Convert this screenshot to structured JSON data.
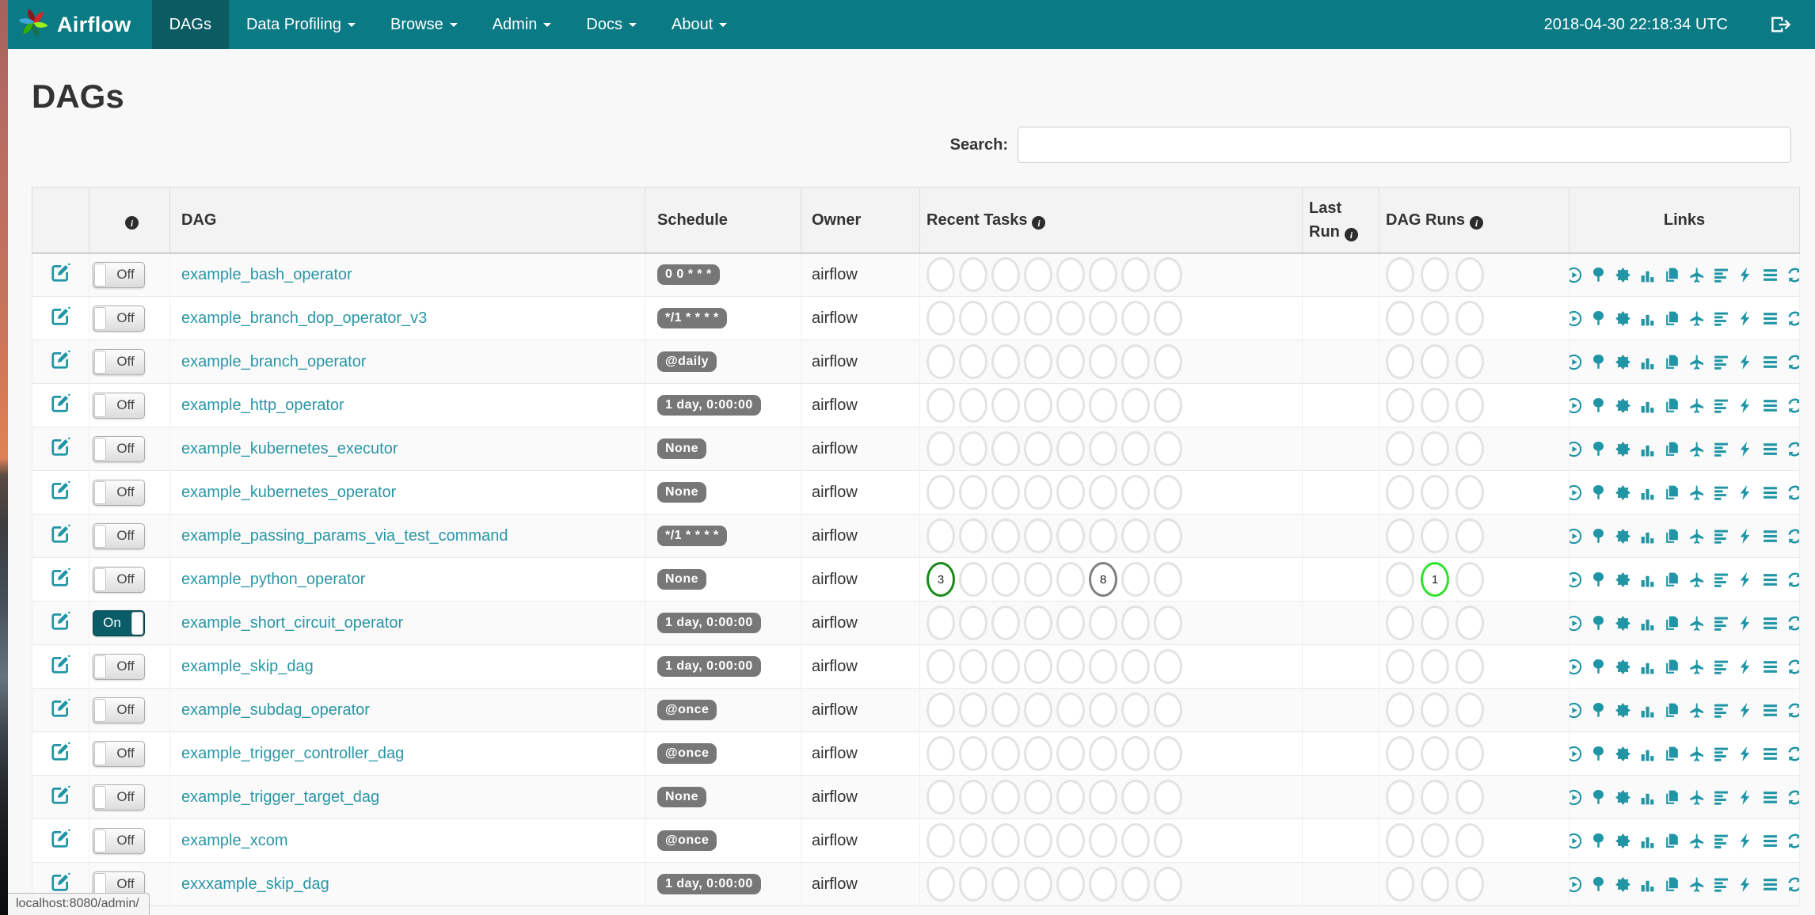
{
  "navbar": {
    "brand": "Airflow",
    "items": [
      {
        "label": "DAGs",
        "active": true,
        "caret": false
      },
      {
        "label": "Data Profiling",
        "active": false,
        "caret": true
      },
      {
        "label": "Browse",
        "active": false,
        "caret": true
      },
      {
        "label": "Admin",
        "active": false,
        "caret": true
      },
      {
        "label": "Docs",
        "active": false,
        "caret": true
      },
      {
        "label": "About",
        "active": false,
        "caret": true
      }
    ],
    "clock": "2018-04-30 22:18:34 UTC",
    "icons": [
      "airflow-pinwheel-logo",
      "sign-out-icon"
    ]
  },
  "page": {
    "title": "DAGs",
    "search_label": "Search:",
    "search_value": "",
    "status_bar": "localhost:8080/admin/"
  },
  "table": {
    "headers": {
      "dag": "DAG",
      "schedule": "Schedule",
      "owner": "Owner",
      "recent_tasks": "Recent Tasks",
      "last_run": "Last Run",
      "dag_runs": "DAG Runs",
      "links": "Links"
    },
    "links_icons": [
      "trigger-dag",
      "tree-view",
      "graph-view",
      "task-duration",
      "task-tries",
      "landing-times",
      "gantt-view",
      "code-view",
      "logs",
      "refresh"
    ],
    "rows": [
      {
        "name": "example_bash_operator",
        "toggle": "Off",
        "schedule": "0 0 * * *",
        "owner": "airflow",
        "last_run": "",
        "recent_tasks": [
          null,
          null,
          null,
          null,
          null,
          null,
          null,
          null
        ],
        "dag_runs": [
          null,
          null,
          null
        ]
      },
      {
        "name": "example_branch_dop_operator_v3",
        "toggle": "Off",
        "schedule": "*/1 * * * *",
        "owner": "airflow",
        "last_run": "",
        "recent_tasks": [
          null,
          null,
          null,
          null,
          null,
          null,
          null,
          null
        ],
        "dag_runs": [
          null,
          null,
          null
        ]
      },
      {
        "name": "example_branch_operator",
        "toggle": "Off",
        "schedule": "@daily",
        "owner": "airflow",
        "last_run": "",
        "recent_tasks": [
          null,
          null,
          null,
          null,
          null,
          null,
          null,
          null
        ],
        "dag_runs": [
          null,
          null,
          null
        ]
      },
      {
        "name": "example_http_operator",
        "toggle": "Off",
        "schedule": "1 day, 0:00:00",
        "owner": "airflow",
        "last_run": "",
        "recent_tasks": [
          null,
          null,
          null,
          null,
          null,
          null,
          null,
          null
        ],
        "dag_runs": [
          null,
          null,
          null
        ]
      },
      {
        "name": "example_kubernetes_executor",
        "toggle": "Off",
        "schedule": "None",
        "owner": "airflow",
        "last_run": "",
        "recent_tasks": [
          null,
          null,
          null,
          null,
          null,
          null,
          null,
          null
        ],
        "dag_runs": [
          null,
          null,
          null
        ]
      },
      {
        "name": "example_kubernetes_operator",
        "toggle": "Off",
        "schedule": "None",
        "owner": "airflow",
        "last_run": "",
        "recent_tasks": [
          null,
          null,
          null,
          null,
          null,
          null,
          null,
          null
        ],
        "dag_runs": [
          null,
          null,
          null
        ]
      },
      {
        "name": "example_passing_params_via_test_command",
        "toggle": "Off",
        "schedule": "*/1 * * * *",
        "owner": "airflow",
        "last_run": "",
        "recent_tasks": [
          null,
          null,
          null,
          null,
          null,
          null,
          null,
          null
        ],
        "dag_runs": [
          null,
          null,
          null
        ]
      },
      {
        "name": "example_python_operator",
        "toggle": "Off",
        "schedule": "None",
        "owner": "airflow",
        "last_run": "",
        "recent_tasks": [
          {
            "count": 3,
            "color": "#1b8a1b"
          },
          null,
          null,
          null,
          null,
          {
            "count": 8,
            "color": "#808080"
          },
          null,
          null
        ],
        "dag_runs": [
          null,
          {
            "count": 1,
            "color": "#2ee22e"
          },
          null
        ]
      },
      {
        "name": "example_short_circuit_operator",
        "toggle": "On",
        "schedule": "1 day, 0:00:00",
        "owner": "airflow",
        "last_run": "",
        "recent_tasks": [
          null,
          null,
          null,
          null,
          null,
          null,
          null,
          null
        ],
        "dag_runs": [
          null,
          null,
          null
        ]
      },
      {
        "name": "example_skip_dag",
        "toggle": "Off",
        "schedule": "1 day, 0:00:00",
        "owner": "airflow",
        "last_run": "",
        "recent_tasks": [
          null,
          null,
          null,
          null,
          null,
          null,
          null,
          null
        ],
        "dag_runs": [
          null,
          null,
          null
        ]
      },
      {
        "name": "example_subdag_operator",
        "toggle": "Off",
        "schedule": "@once",
        "owner": "airflow",
        "last_run": "",
        "recent_tasks": [
          null,
          null,
          null,
          null,
          null,
          null,
          null,
          null
        ],
        "dag_runs": [
          null,
          null,
          null
        ]
      },
      {
        "name": "example_trigger_controller_dag",
        "toggle": "Off",
        "schedule": "@once",
        "owner": "airflow",
        "last_run": "",
        "recent_tasks": [
          null,
          null,
          null,
          null,
          null,
          null,
          null,
          null
        ],
        "dag_runs": [
          null,
          null,
          null
        ]
      },
      {
        "name": "example_trigger_target_dag",
        "toggle": "Off",
        "schedule": "None",
        "owner": "airflow",
        "last_run": "",
        "recent_tasks": [
          null,
          null,
          null,
          null,
          null,
          null,
          null,
          null
        ],
        "dag_runs": [
          null,
          null,
          null
        ]
      },
      {
        "name": "example_xcom",
        "toggle": "Off",
        "schedule": "@once",
        "owner": "airflow",
        "last_run": "",
        "recent_tasks": [
          null,
          null,
          null,
          null,
          null,
          null,
          null,
          null
        ],
        "dag_runs": [
          null,
          null,
          null
        ]
      },
      {
        "name": "exxxample_skip_dag",
        "toggle": "Off",
        "schedule": "1 day, 0:00:00",
        "owner": "airflow",
        "last_run": "",
        "recent_tasks": [
          null,
          null,
          null,
          null,
          null,
          null,
          null,
          null
        ],
        "dag_runs": [
          null,
          null,
          null
        ]
      }
    ]
  },
  "colors": {
    "navbar_bg": "#0a7a84",
    "navbar_active_bg": "#0b5b63",
    "link_teal": "#2a96a5",
    "icon_teal": "#2095a5",
    "badge_gray": "#777777",
    "circle_empty": "#e3e3e3",
    "circle_success_green": "#1b8a1b",
    "circle_neutral_gray": "#808080",
    "circle_running_lime": "#2ee22e",
    "toggle_on_bg": "#0a5c66"
  }
}
